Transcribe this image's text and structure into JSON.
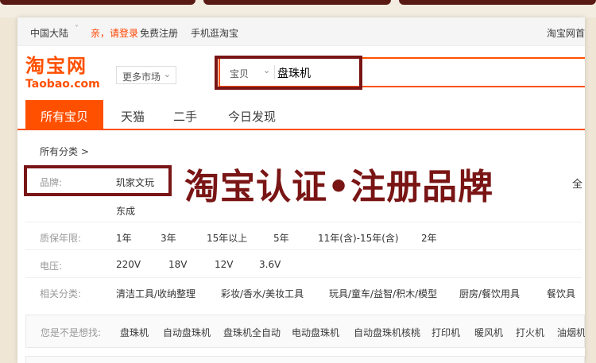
{
  "site_nav": {
    "region": "中国大陆",
    "login": "亲，请登录",
    "register": "免费注册",
    "mobile": "手机逛淘宝",
    "right_link": "淘宝网首"
  },
  "logo": {
    "cn": "淘宝网",
    "en": "Taobao.com"
  },
  "market_select": {
    "value": "更多市场"
  },
  "search": {
    "scope": "宝贝",
    "value": "盘珠机"
  },
  "tabs": [
    "所有宝贝",
    "天猫",
    "二手",
    "今日发现"
  ],
  "crumb": "所有分类 >",
  "overlay_title": "淘宝认证•注册品牌",
  "filters": {
    "brand": {
      "label": "品牌:",
      "options": [
        "玑家文玩",
        "东成"
      ],
      "right_fragment": "全"
    },
    "warranty": {
      "label": "质保年限:",
      "options": [
        "1年",
        "3年",
        "15年以上",
        "5年",
        "11年(含)-15年(含)",
        "2年"
      ]
    },
    "voltage": {
      "label": "电压:",
      "options": [
        "220V",
        "18V",
        "12V",
        "3.6V"
      ]
    },
    "category": {
      "label": "相关分类:",
      "options": [
        "清洁工具/收纳整理",
        "彩妆/香水/美妆工具",
        "玩具/童车/益智/积木/模型",
        "厨房/餐饮用具",
        "餐饮具"
      ]
    }
  },
  "suggest": {
    "label": "您是不是想找:",
    "items": [
      "盘珠机",
      "自动盘珠机",
      "盘珠机全自动",
      "电动盘珠机",
      "自动盘珠机核桃",
      "打印机",
      "暖风机",
      "打火机",
      "油烟机"
    ]
  },
  "colors": {
    "accent": "#ff5000",
    "highlight": "#7a1515"
  }
}
